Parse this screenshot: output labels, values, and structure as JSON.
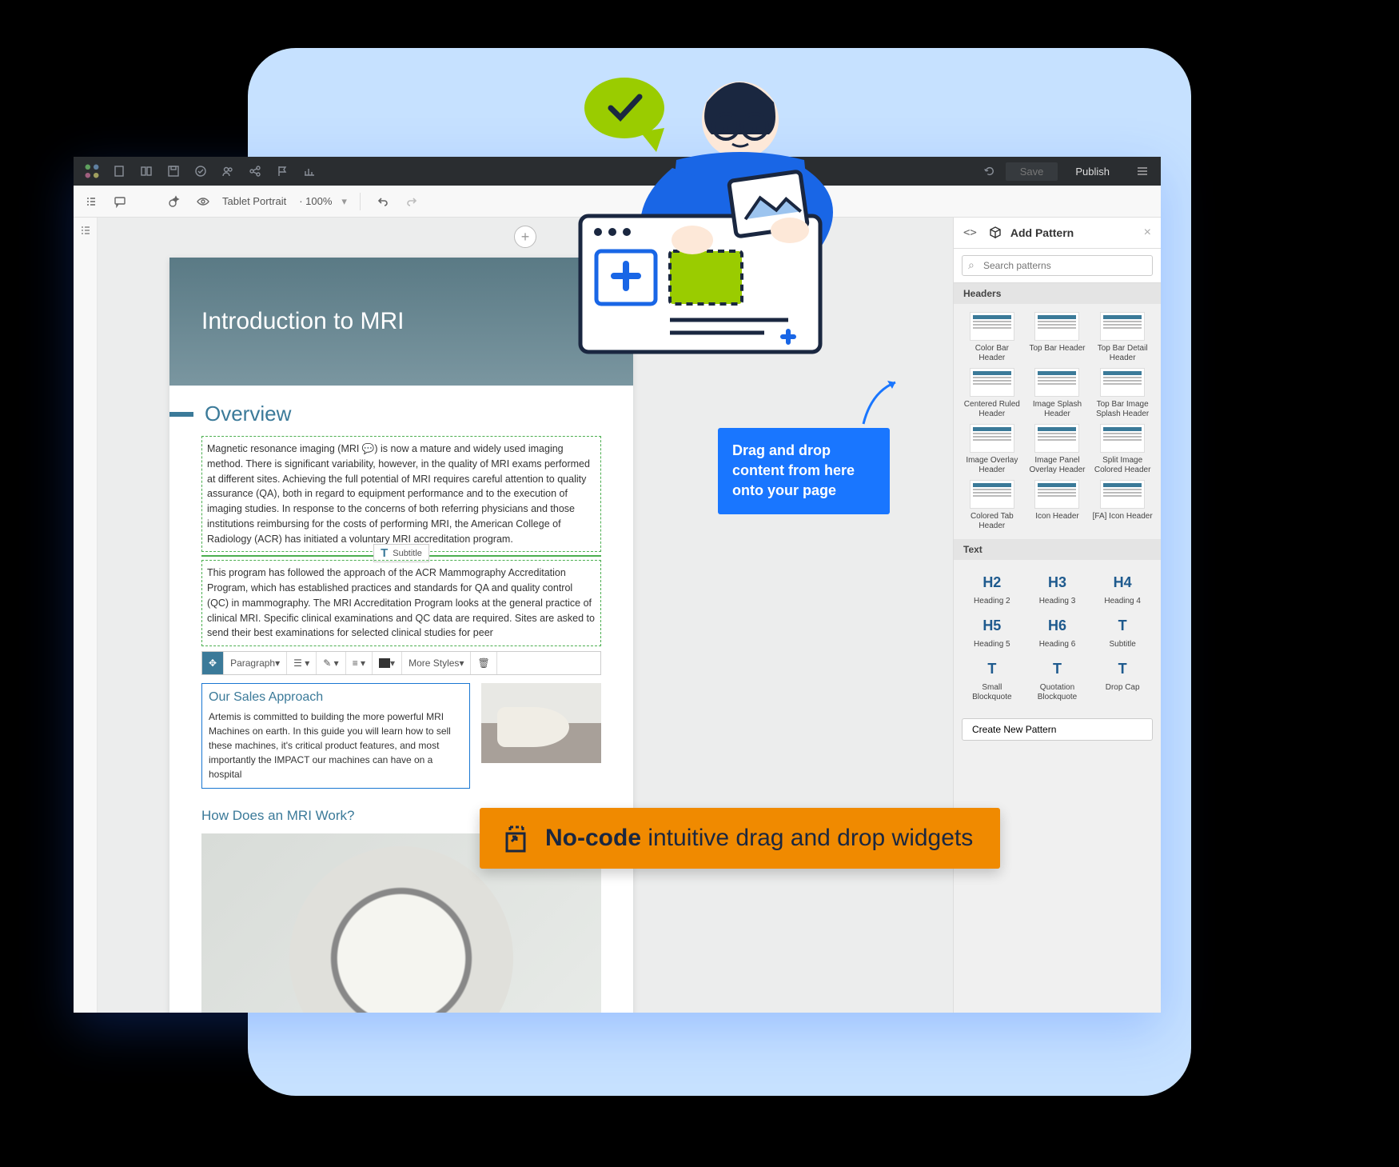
{
  "topbar": {
    "save": "Save",
    "publish": "Publish"
  },
  "secondbar": {
    "view_mode": "Tablet Portrait",
    "zoom": "100%"
  },
  "page": {
    "hero_title": "Introduction to MRI",
    "overview_heading": "Overview",
    "para1": "Magnetic resonance imaging (MRI 💬) is now a mature and widely used imaging method. There is significant variability, however, in the quality of MRI exams performed at different sites. Achieving the full potential of MRI requires careful attention to quality assurance (QA), both in regard to equipment performance and to the execution of imaging studies. In response to the concerns of both referring physicians and those institutions reimbursing for the costs of performing MRI, the American College of Radiology (ACR) has initiated a voluntary MRI accreditation program.",
    "insert_label": "Subtitle",
    "para2": "This program has followed the approach of the ACR Mammography Accreditation Program, which has established practices and standards for QA and quality control (QC) in mammography. The MRI Accreditation Program looks at the general practice of clinical MRI. Specific clinical examinations and QC data are required. Sites are asked to send their best examinations for selected clinical studies for peer",
    "toolbar": {
      "style": "Paragraph",
      "more": "More Styles"
    },
    "sales_heading": "Our Sales Approach",
    "sales_body": "Artemis is committed to building the more powerful MRI Machines on earth. In this guide you will learn how to sell these machines, it's critical product features, and most importantly the IMPACT our machines can have on a hospital",
    "how_heading": "How Does an MRI Work?"
  },
  "panel": {
    "title": "Add Pattern",
    "search_placeholder": "Search patterns",
    "section_headers": "Headers",
    "section_text": "Text",
    "headers": [
      "Color Bar Header",
      "Top Bar Header",
      "Top Bar Detail Header",
      "Centered Ruled Header",
      "Image Splash Header",
      "Top Bar Image Splash Header",
      "Image Overlay Header",
      "Image Panel Overlay Header",
      "Split Image Colored Header",
      "Colored Tab Header",
      "Icon Header",
      "[FA] Icon Header"
    ],
    "text_items": [
      {
        "big": "H2",
        "label": "Heading 2"
      },
      {
        "big": "H3",
        "label": "Heading 3"
      },
      {
        "big": "H4",
        "label": "Heading 4"
      },
      {
        "big": "H5",
        "label": "Heading 5"
      },
      {
        "big": "H6",
        "label": "Heading 6"
      },
      {
        "big": "T",
        "label": "Subtitle"
      },
      {
        "big": "T",
        "label": "Small Blockquote"
      },
      {
        "big": "T",
        "label": "Quotation Blockquote"
      },
      {
        "big": "T",
        "label": "Drop Cap"
      }
    ],
    "create_btn": "Create New Pattern"
  },
  "callouts": {
    "blue": "Drag and drop content from here onto your page",
    "orange_bold": "No-code",
    "orange_rest": " intuitive drag and drop widgets"
  }
}
